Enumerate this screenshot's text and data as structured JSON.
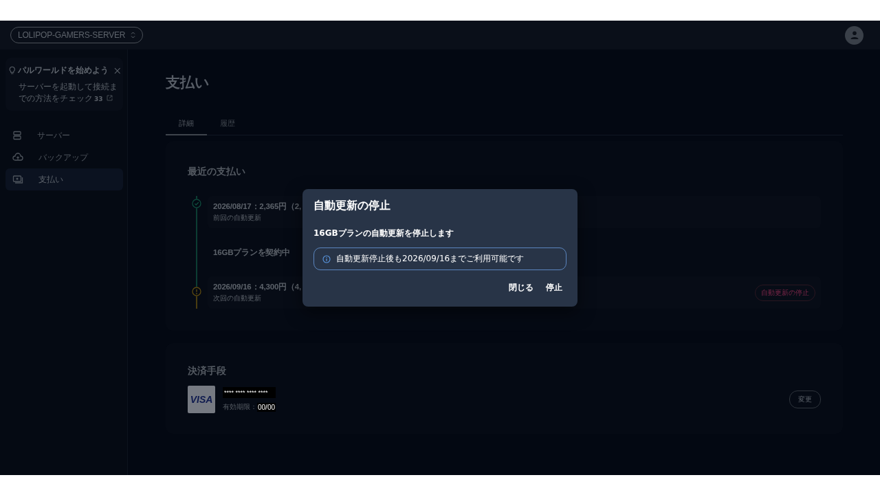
{
  "server_selector": {
    "label": "LOLIPOP-GAMERS-SERVER"
  },
  "guide": {
    "title": "パルワールドを始めよう",
    "text": "サーバーを起動して接続までの方法をチェック",
    "badge": "33"
  },
  "sidebar": {
    "items": [
      {
        "label": "サーバー",
        "kind": "server",
        "selected": false
      },
      {
        "label": "バックアップ",
        "kind": "backup",
        "selected": false
      },
      {
        "label": "支払い",
        "kind": "payment",
        "selected": true
      }
    ]
  },
  "page_title": "支払い",
  "tabs": [
    {
      "label": "詳細",
      "selected": true
    },
    {
      "label": "履歴",
      "selected": false
    }
  ],
  "recent_payments": {
    "title": "最近の支払い",
    "timeline": [
      {
        "kind": "done",
        "title": "2026/08/17：2,365円（2,",
        "subtitle": "前回の自動更新"
      },
      {
        "kind": "plan",
        "title": "16GBプランを契約中"
      },
      {
        "kind": "upcoming",
        "title": "2026/09/16：4,300円（4,",
        "subtitle": "次回の自動更新",
        "action": "自動更新の停止"
      }
    ]
  },
  "payment_method": {
    "title": "決済手段",
    "brand": "VISA",
    "card_number": "**** **** **** ****",
    "expiry_label": "有効期限：",
    "expiry": "00/00",
    "change_button": "変更"
  },
  "dialog": {
    "title": "自動更新の停止",
    "message": "16GBプランの自動更新を停止します",
    "info": "自動更新停止後も2026/09/16までご利用可能です",
    "buttons": [
      "閉じる",
      "停止"
    ]
  }
}
